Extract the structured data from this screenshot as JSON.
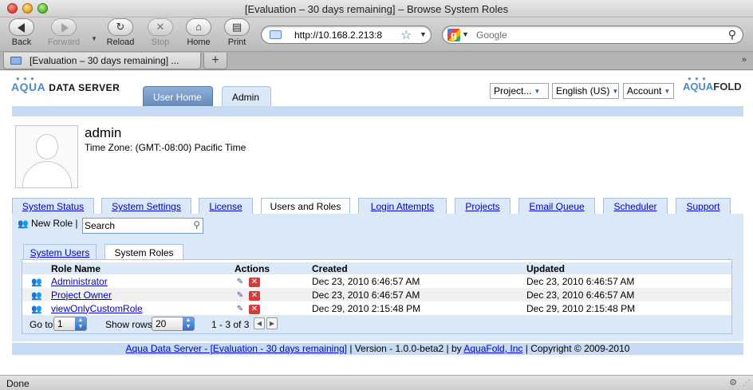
{
  "window": {
    "title": "[Evaluation – 30 days remaining] – Browse System Roles"
  },
  "toolbar": {
    "back": "Back",
    "forward": "Forward",
    "reload": "Reload",
    "stop": "Stop",
    "home": "Home",
    "print": "Print",
    "url": "http://10.168.2.213:8",
    "search_placeholder": "Google"
  },
  "browser_tabs": [
    {
      "title": "[Evaluation – 30 days remaining] ..."
    }
  ],
  "app": {
    "logo_left": {
      "aqua": "AQUA",
      "rest": "DATA SERVER"
    },
    "logo_right": {
      "a": "AQUA",
      "f": "FOLD"
    },
    "main_tabs": [
      {
        "label": "User Home"
      },
      {
        "label": "Admin"
      }
    ],
    "selects": {
      "project": "Project...",
      "language": "English (US)",
      "account": "Account"
    }
  },
  "user": {
    "name": "admin",
    "timezone": "Time Zone: (GMT:-08:00) Pacific Time"
  },
  "admin_tabs": [
    {
      "label": "System Status"
    },
    {
      "label": "System Settings"
    },
    {
      "label": "License"
    },
    {
      "label": "Users and Roles"
    },
    {
      "label": "Login Attempts"
    },
    {
      "label": "Projects"
    },
    {
      "label": "Email Queue"
    },
    {
      "label": "Scheduler"
    },
    {
      "label": "Support"
    }
  ],
  "role_toolbar": {
    "new_role": "New Role",
    "separator": "|",
    "search_value": "Search"
  },
  "inner_tabs": [
    {
      "label": "System Users"
    },
    {
      "label": "System Roles"
    }
  ],
  "table": {
    "headers": {
      "name": "Role Name",
      "actions": "Actions",
      "created": "Created",
      "updated": "Updated"
    },
    "rows": [
      {
        "name": "Administrator",
        "created": "Dec 23, 2010 6:46:57 AM",
        "updated": "Dec 23, 2010 6:46:57 AM"
      },
      {
        "name": "Project Owner",
        "created": "Dec 23, 2010 6:46:57 AM",
        "updated": "Dec 23, 2010 6:46:57 AM"
      },
      {
        "name": "viewOnlyCustomRole",
        "created": "Dec 29, 2010 2:15:48 PM",
        "updated": "Dec 29, 2010 2:15:48 PM"
      }
    ]
  },
  "pager": {
    "goto_label": "Go to",
    "page": "1",
    "rows_label": "Show rows",
    "rows": "20",
    "range": "1 - 3 of 3"
  },
  "footer": {
    "product_link": "Aqua Data Server - [Evaluation - 30 days remaining]",
    "version": "| Version - 1.0.0-beta2 | by",
    "company_link": "AquaFold, Inc",
    "copyright": "| Copyright © 2009-2010"
  },
  "status": {
    "text": "Done"
  },
  "colors": {
    "band": "#c6daf4",
    "tab_bg": "#dbe8f8",
    "link": "#0000cc",
    "user_home_tab": "#6789b7"
  }
}
